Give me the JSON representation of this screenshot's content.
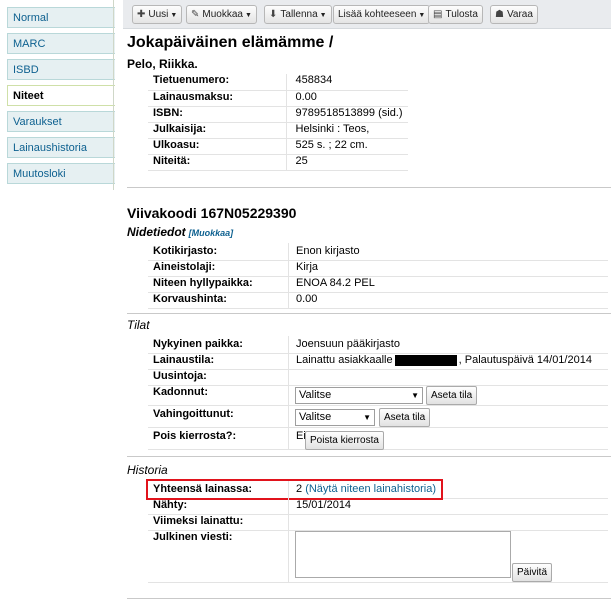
{
  "sidebar": {
    "tabs": [
      "Normal",
      "MARC",
      "ISBD",
      "Niteet",
      "Varaukset",
      "Lainaushistoria",
      "Muutosloki"
    ],
    "active": "Niteet"
  },
  "toolbar": {
    "new_label": "Uusi",
    "edit_label": "Muokkaa",
    "save_label": "Tallenna",
    "add_to_label": "Lisää kohteeseen",
    "print_label": "Tulosta",
    "reserve_label": "Varaa"
  },
  "record": {
    "title": "Jokapäiväinen elämämme /",
    "author": "Pelo, Riikka.",
    "fields": [
      {
        "label": "Tietuenumero:",
        "value": "458834"
      },
      {
        "label": "Lainausmaksu:",
        "value": "0.00"
      },
      {
        "label": "ISBN:",
        "value": "9789518513899 (sid.)"
      },
      {
        "label": "Julkaisija:",
        "value": "Helsinki : Teos,"
      },
      {
        "label": "Ulkoasu:",
        "value": "525 s. ; 22 cm."
      },
      {
        "label": "Niteitä:",
        "value": "25"
      }
    ]
  },
  "item": {
    "barcode_heading": "Viivakoodi 167N05229390",
    "details_heading": "Nidetiedot",
    "details_edit": "[Muokkaa]",
    "details": [
      {
        "label": "Kotikirjasto:",
        "value": "Enon kirjasto"
      },
      {
        "label": "Aineistolaji:",
        "value": "Kirja"
      },
      {
        "label": "Niteen hyllypaikka:",
        "value": "ENOA 84.2 PEL"
      },
      {
        "label": "Korvaushinta:",
        "value": "0.00"
      }
    ],
    "status_heading": "Tilat",
    "current_location_label": "Nykyinen paikka:",
    "current_location_value": "Joensuun pääkirjasto",
    "loan_status_label": "Lainaustila:",
    "loan_status_prefix": "Lainattu asiakkaalle",
    "loan_status_suffix": ", Palautuspäivä 14/01/2014",
    "renewals_label": "Uusintoja:",
    "lost_label": "Kadonnut:",
    "lost_select": "Valitse",
    "lost_button": "Aseta tila",
    "damaged_label": "Vahingoittunut:",
    "damaged_select": "Valitse",
    "damaged_button": "Aseta tila",
    "withdrawn_label": "Pois kierrosta?:",
    "withdrawn_value": "Ei",
    "withdrawn_button": "Poista kierrosta",
    "history_heading": "Historia",
    "total_loans_label": "Yhteensä lainassa:",
    "total_loans_value": "2",
    "total_loans_link": "(Näytä niteen lainahistoria)",
    "seen_label": "Nähty:",
    "seen_value": "15/01/2014",
    "last_loaned_label": "Viimeksi lainattu:",
    "public_note_label": "Julkinen viesti:",
    "update_button": "Päivitä"
  },
  "colors": {
    "highlight": "#e1131c",
    "link": "#0e6190"
  }
}
